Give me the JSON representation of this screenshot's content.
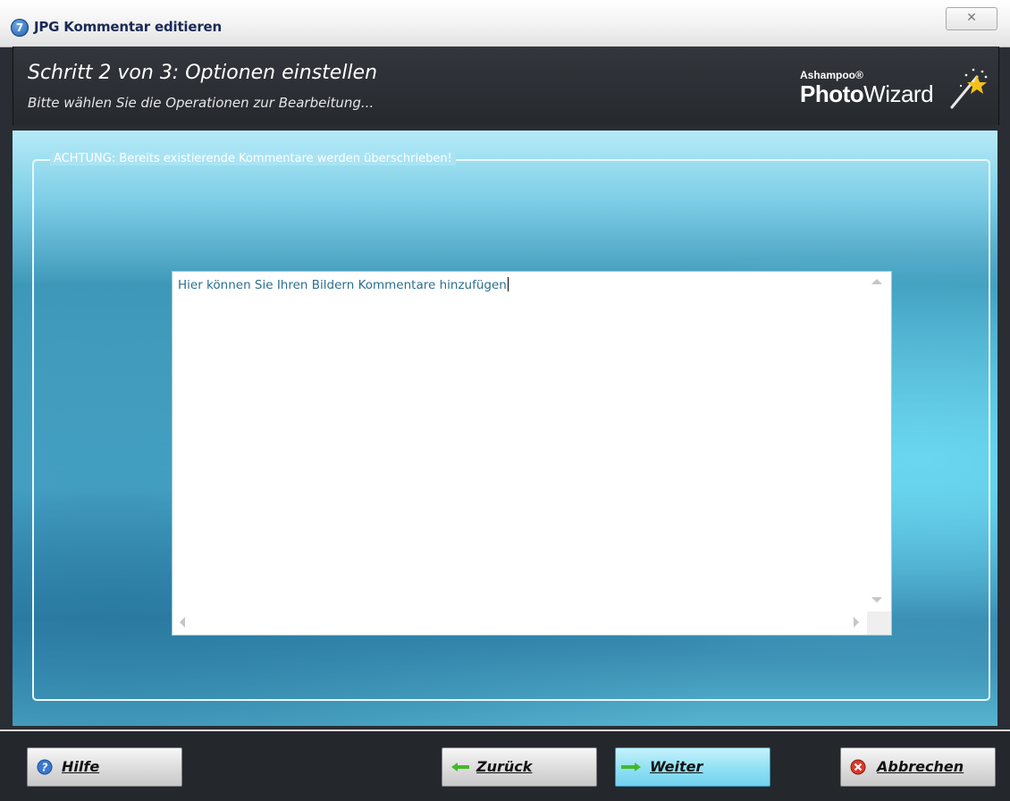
{
  "window": {
    "title": "JPG Kommentar editieren",
    "close_glyph": "✕"
  },
  "header": {
    "step_title": "Schritt 2 von 3: Optionen einstellen",
    "step_subtitle": "Bitte wählen Sie die Operationen zur Bearbeitung...",
    "brand_small": "Ashampoo®",
    "brand_name_bold": "Photo",
    "brand_name_rest": "Wizard"
  },
  "main": {
    "group_legend": "ACHTUNG: Bereits existierende Kommentare werden überschrieben!",
    "comment_text": "Hier können Sie Ihren Bildern Kommentare hinzufügen"
  },
  "footer": {
    "help_label": "Hilfe",
    "back_label": "Zurück",
    "next_label": "Weiter",
    "cancel_label": "Abbrechen"
  },
  "colors": {
    "accent": "#71d1ec",
    "header_bg": "#2a2d33",
    "text_color": "#2a6f8f"
  },
  "icons": [
    "app-icon",
    "wand-icon",
    "help-icon",
    "back-arrow-icon",
    "next-arrow-icon",
    "cancel-icon"
  ]
}
